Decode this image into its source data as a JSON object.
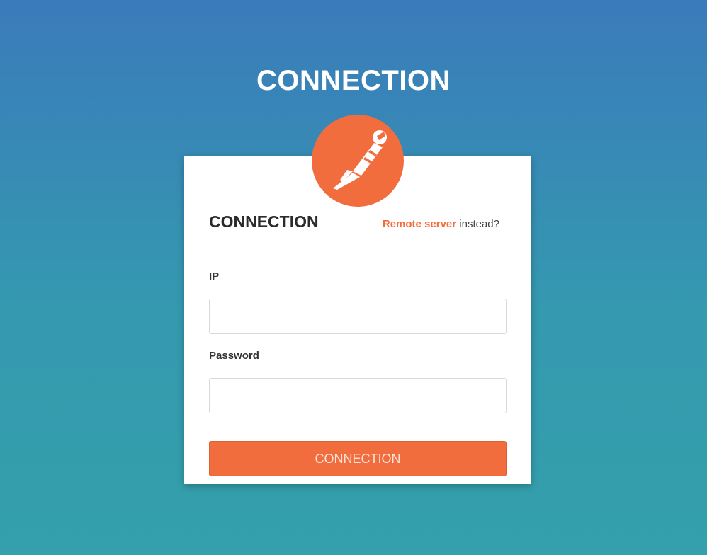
{
  "header": {
    "title": "CONNECTION"
  },
  "logo": {
    "icon": "postman-rocketman-icon",
    "color": "#f26d3d"
  },
  "card": {
    "title": "CONNECTION",
    "remote_link_label": "Remote server",
    "remote_suffix": " instead?"
  },
  "form": {
    "ip_label": "IP",
    "ip_value": "",
    "password_label": "Password",
    "password_value": "",
    "submit_label": "CONNECTION"
  },
  "colors": {
    "accent": "#f26d3d",
    "background_top": "#3a7bbb",
    "background_bottom": "#34a0ab"
  }
}
